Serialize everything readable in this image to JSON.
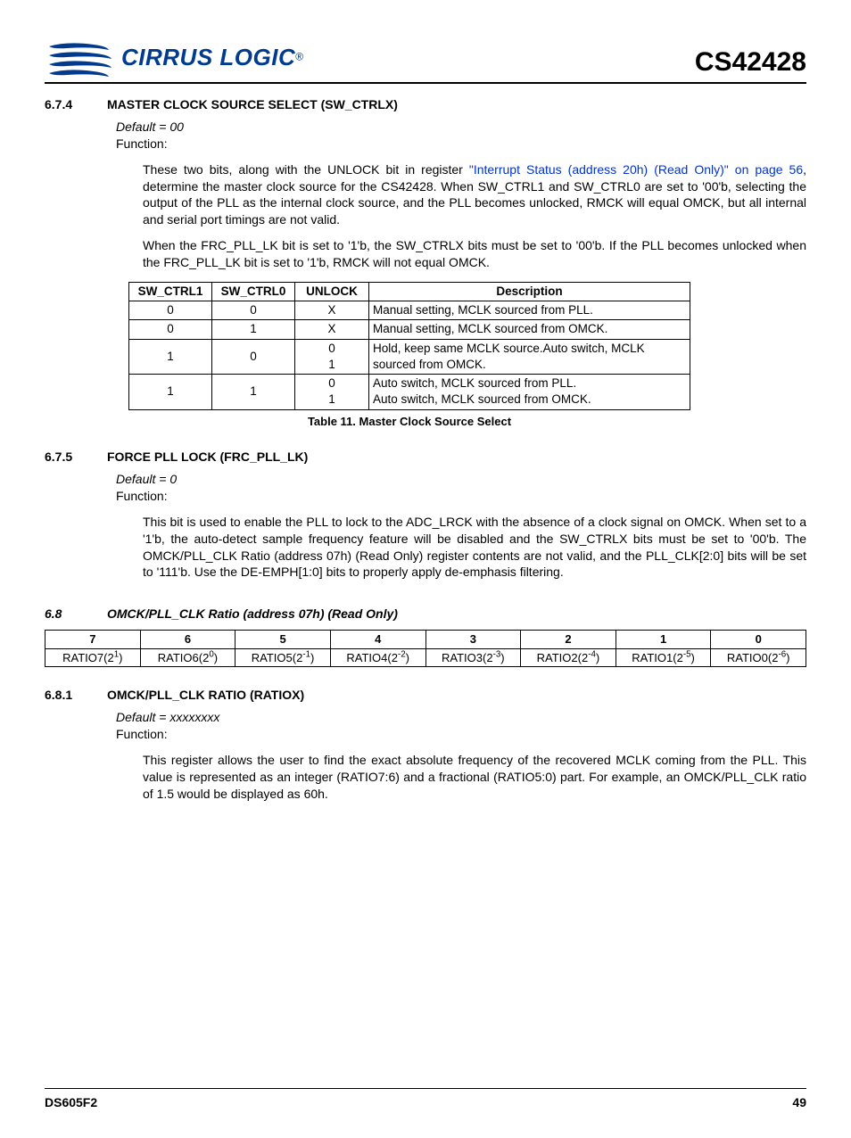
{
  "header": {
    "logo_text": "CIRRUS LOGIC",
    "part_number": "CS42428"
  },
  "s674": {
    "num": "6.7.4",
    "title": "MASTER CLOCK SOURCE SELECT (SW_CTRLX)",
    "default": "Default = 00",
    "function": "Function:",
    "p1_a": "These two bits, along with the UNLOCK bit in register ",
    "p1_link": "\"Interrupt Status (address 20h) (Read Only)\" on page 56",
    "p1_b": ", determine the master clock source for the CS42428. When SW_CTRL1 and SW_CTRL0 are set to '00'b, selecting the output of the PLL as the internal clock source, and the PLL becomes unlocked, RMCK will equal OMCK, but all internal and serial port timings are not valid.",
    "p2": "When the FRC_PLL_LK bit is set to '1'b, the SW_CTRLX bits must be set to '00'b. If the PLL becomes unlocked when the FRC_PLL_LK bit is set to '1'b, RMCK will not equal OMCK."
  },
  "table11": {
    "h1": "SW_CTRL1",
    "h2": "SW_CTRL0",
    "h3": "UNLOCK",
    "h4": "Description",
    "r1": {
      "c1": "0",
      "c2": "0",
      "c3": "X",
      "c4": "Manual setting, MCLK sourced from PLL."
    },
    "r2": {
      "c1": "0",
      "c2": "1",
      "c3": "X",
      "c4": "Manual setting, MCLK sourced from OMCK."
    },
    "r3": {
      "c1": "1",
      "c2": "0",
      "c3a": "0",
      "c3b": "1",
      "c4": "Hold, keep same MCLK source.Auto switch, MCLK sourced from OMCK."
    },
    "r4": {
      "c1": "1",
      "c2": "1",
      "c3a": "0",
      "c3b": "1",
      "c4a": "Auto switch, MCLK sourced from PLL.",
      "c4b": "Auto switch, MCLK sourced from OMCK."
    },
    "caption": "Table 11. Master Clock Source Select"
  },
  "s675": {
    "num": "6.7.5",
    "title": "FORCE PLL LOCK (FRC_PLL_LK)",
    "default": "Default = 0",
    "function": "Function:",
    "p1": "This bit is used to enable the PLL to lock to the ADC_LRCK with the absence of a clock signal on OMCK. When set to a '1'b, the auto-detect sample frequency feature will be disabled and the SW_CTRLX bits must be set to '00'b. The OMCK/PLL_CLK Ratio (address 07h) (Read Only) register contents are not valid, and the PLL_CLK[2:0] bits will be set to '111'b. Use the DE-EMPH[1:0] bits to properly apply de-emphasis filtering."
  },
  "s68": {
    "num": "6.8",
    "title": "OMCK/PLL_CLK Ratio (address 07h) (Read Only)"
  },
  "bits": {
    "h": [
      "7",
      "6",
      "5",
      "4",
      "3",
      "2",
      "1",
      "0"
    ],
    "r": [
      {
        "name": "RATIO7(2",
        "exp": "1",
        "suf": ")"
      },
      {
        "name": "RATIO6(2",
        "exp": "0",
        "suf": ")"
      },
      {
        "name": "RATIO5(2",
        "exp": "-1",
        "suf": ")"
      },
      {
        "name": "RATIO4(2",
        "exp": "-2",
        "suf": ")"
      },
      {
        "name": "RATIO3(2",
        "exp": "-3",
        "suf": ")"
      },
      {
        "name": "RATIO2(2",
        "exp": "-4",
        "suf": ")"
      },
      {
        "name": "RATIO1(2",
        "exp": "-5",
        "suf": ")"
      },
      {
        "name": "RATIO0(2",
        "exp": "-6",
        "suf": ")"
      }
    ]
  },
  "s681": {
    "num": "6.8.1",
    "title": "OMCK/PLL_CLK RATIO (RATIOX)",
    "default": "Default = xxxxxxxx",
    "function": "Function:",
    "p1": "This register allows the user to find the exact absolute frequency of the recovered MCLK coming from the PLL. This value is represented as an integer (RATIO7:6) and a fractional (RATIO5:0) part. For example, an OMCK/PLL_CLK ratio of 1.5 would be displayed as 60h."
  },
  "footer": {
    "doc": "DS605F2",
    "page": "49"
  }
}
